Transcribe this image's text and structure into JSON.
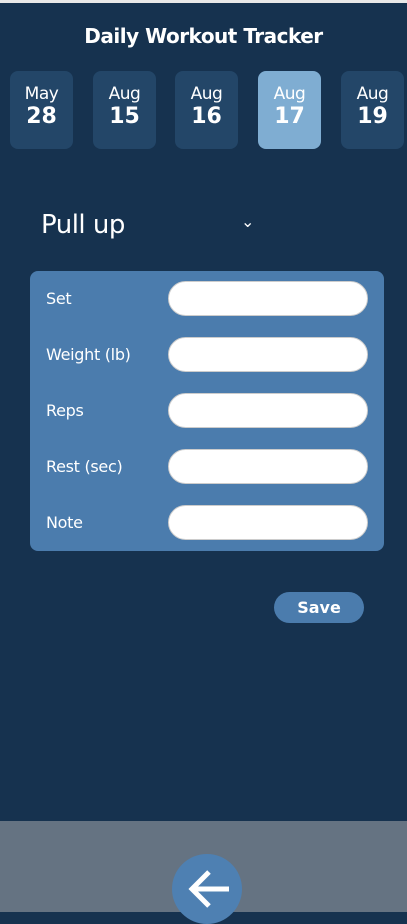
{
  "header": {
    "title": "Daily Workout Tracker"
  },
  "dates": [
    {
      "month": "May",
      "day": "28"
    },
    {
      "month": "Aug",
      "day": "15"
    },
    {
      "month": "Aug",
      "day": "16"
    },
    {
      "month": "Aug",
      "day": "17",
      "selected": true
    },
    {
      "month": "Aug",
      "day": "19"
    }
  ],
  "exercise": {
    "selected": "Pull up"
  },
  "form": {
    "fields": [
      {
        "label": "Set",
        "value": ""
      },
      {
        "label": "Weight (lb)",
        "value": ""
      },
      {
        "label": "Reps",
        "value": ""
      },
      {
        "label": "Rest (sec)",
        "value": ""
      },
      {
        "label": "Note",
        "value": ""
      }
    ]
  },
  "save_label": "Save",
  "colors": {
    "background": "#16324f",
    "accent": "#4b7cad",
    "selected_date": "#7fadd2",
    "bottom_bar": "#657382"
  }
}
